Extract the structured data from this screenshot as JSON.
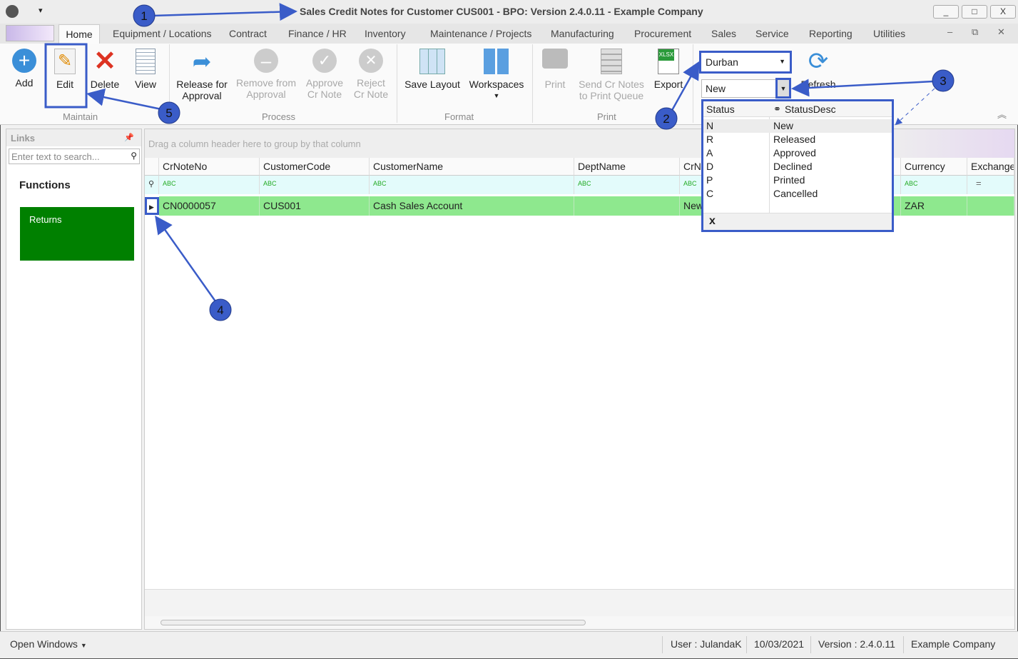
{
  "window": {
    "title": "Sales Credit Notes for Customer CUS001 - BPO: Version 2.4.0.11 - Example Company",
    "min": "_",
    "max": "□",
    "close": "X"
  },
  "tabs": [
    "Home",
    "Equipment / Locations",
    "Contract",
    "Finance / HR",
    "Inventory",
    "Maintenance / Projects",
    "Manufacturing",
    "Procurement",
    "Sales",
    "Service",
    "Reporting",
    "Utilities"
  ],
  "ribbon": {
    "maintain": {
      "label": "Maintain",
      "add": "Add",
      "edit": "Edit",
      "delete": "Delete",
      "view": "View"
    },
    "process": {
      "label": "Process",
      "release": "Release for Approval",
      "remove": "Remove from Approval",
      "approve": "Approve Cr Note",
      "reject": "Reject Cr Note"
    },
    "format": {
      "label": "Format",
      "save_layout": "Save Layout",
      "workspaces": "Workspaces"
    },
    "print": {
      "label": "Print",
      "print": "Print",
      "send": "Send Cr Notes to Print Queue",
      "export": "Export"
    },
    "site_combo": "Durban",
    "status_combo": "New",
    "refresh": "Refresh"
  },
  "status_dropdown": {
    "headers": [
      "Status",
      "StatusDesc"
    ],
    "rows": [
      [
        "N",
        "New"
      ],
      [
        "R",
        "Released"
      ],
      [
        "A",
        "Approved"
      ],
      [
        "D",
        "Declined"
      ],
      [
        "P",
        "Printed"
      ],
      [
        "C",
        "Cancelled"
      ]
    ],
    "clear": "x"
  },
  "links": {
    "title": "Links",
    "search_placeholder": "Enter text to search...",
    "functions": "Functions",
    "returns": "Returns"
  },
  "grid": {
    "group_hint": "Drag a column header here to group by that column",
    "columns": [
      "CrNoteNo",
      "CustomerCode",
      "CustomerName",
      "DeptName",
      "CrN",
      "Currency",
      "Exchange"
    ],
    "rows": [
      {
        "CrNoteNo": "CN0000057",
        "CustomerCode": "CUS001",
        "CustomerName": "Cash Sales Account",
        "DeptName": "",
        "CrN": "New",
        "Currency": "ZAR",
        "Exchange": ""
      }
    ]
  },
  "statusbar": {
    "open_windows": "Open Windows",
    "user": "User : JulandaK",
    "date": "10/03/2021",
    "version": "Version : 2.4.0.11",
    "company": "Example Company"
  },
  "annotations": [
    "1",
    "2",
    "3",
    "4",
    "5"
  ],
  "colors": {
    "annotation": "#3a5cc8",
    "selected_row": "#8ee88e",
    "functions_tile": "#008000"
  }
}
